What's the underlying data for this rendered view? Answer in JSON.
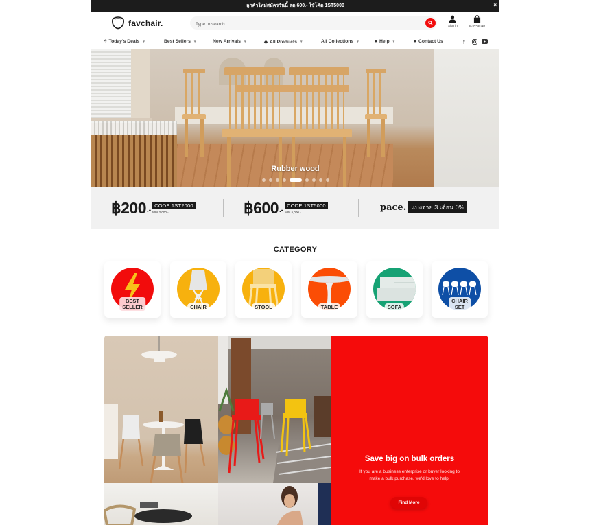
{
  "announcement": {
    "text": "ลูกค้าใหม่สมัครวันนี้ ลด 600.- ใช้โค้ด 1ST5000",
    "close_label": "×"
  },
  "header": {
    "logo_text": "favchair.",
    "search_placeholder": "Type to search...",
    "signin_label": "Sign in",
    "cart_label": "ตะกร้าสินค้า",
    "accent_color": "#f20c0c"
  },
  "nav": {
    "items": [
      {
        "label": "Today's Deals",
        "icon": "bolt-icon",
        "has_dropdown": true
      },
      {
        "label": "Best Sellers",
        "icon": null,
        "has_dropdown": true
      },
      {
        "label": "New Arrivals",
        "icon": null,
        "has_dropdown": true
      },
      {
        "label": "All Products",
        "icon": "tag-icon",
        "has_dropdown": true
      },
      {
        "label": "All Collections",
        "icon": null,
        "has_dropdown": true
      },
      {
        "label": "Help",
        "icon": "info-icon",
        "has_dropdown": true
      },
      {
        "label": "Contact Us",
        "icon": "chat-icon",
        "has_dropdown": false
      }
    ],
    "social": [
      "facebook-icon",
      "instagram-icon",
      "youtube-icon"
    ],
    "caret": "▾"
  },
  "hero": {
    "caption": "Rubber wood",
    "slide_count": 9,
    "active_slide": 5
  },
  "promos": {
    "coupons": [
      {
        "amount": "฿200",
        "suffix": ".-",
        "code": "CODE 1ST2000",
        "min": "MIN 2,000.-"
      },
      {
        "amount": "฿600",
        "suffix": ".-",
        "code": "CODE 1ST5000",
        "min": "MIN 5,000.-"
      }
    ],
    "pace": {
      "brand": "pace.",
      "tag": "แบ่งจ่าย 3 เดือน 0%"
    }
  },
  "category": {
    "title": "CATEGORY",
    "items": [
      {
        "label": "BEST\nSELLER",
        "color": "#f20c0c",
        "icon": "lightning-icon"
      },
      {
        "label": "CHAIR",
        "color": "#f7b10e",
        "icon": "chair-icon"
      },
      {
        "label": "STOOL",
        "color": "#f7b10e",
        "icon": "stool-icon"
      },
      {
        "label": "TABLE",
        "color": "#fb4d05",
        "icon": "table-icon"
      },
      {
        "label": "SOFA",
        "color": "#16a274",
        "icon": "sofa-icon"
      },
      {
        "label": "CHAIR\nSET",
        "color": "#0e4fa6",
        "icon": "chair-set-icon"
      }
    ]
  },
  "bulk": {
    "title": "Save big on bulk orders",
    "text": "If you are a business enterprise or buyer looking to make a bulk purchase, we'd love to help.",
    "button_label": "Find More",
    "color": "#f50b0b"
  }
}
